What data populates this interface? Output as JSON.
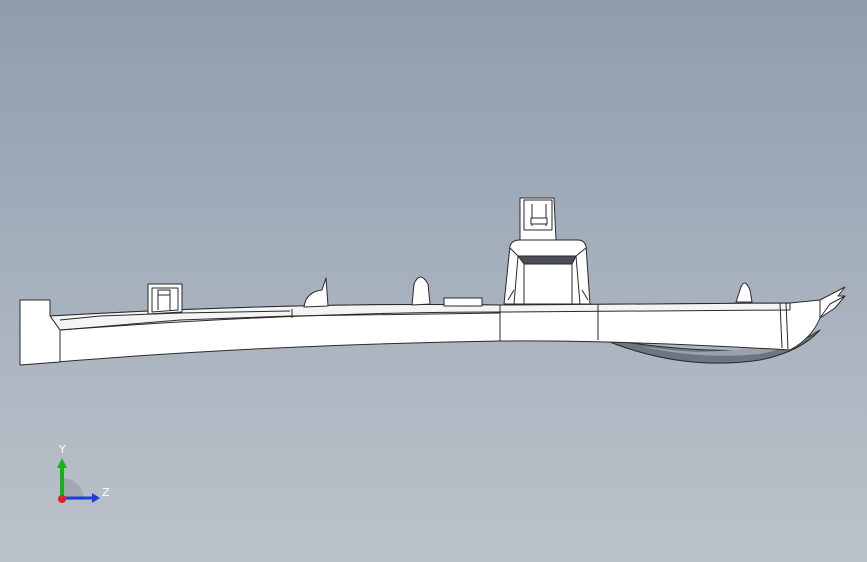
{
  "viewport": {
    "background_top": "#8e9cad",
    "background_bottom": "#bcc2ca"
  },
  "part": {
    "face_color": "#ffffff",
    "edge_color": "#2a2a2a",
    "shadow_color": "#6d7580"
  },
  "triad": {
    "y_label": "Y",
    "z_label": "Z",
    "x_color": "#e02020",
    "y_color": "#19b019",
    "z_color": "#1f3fd6"
  }
}
